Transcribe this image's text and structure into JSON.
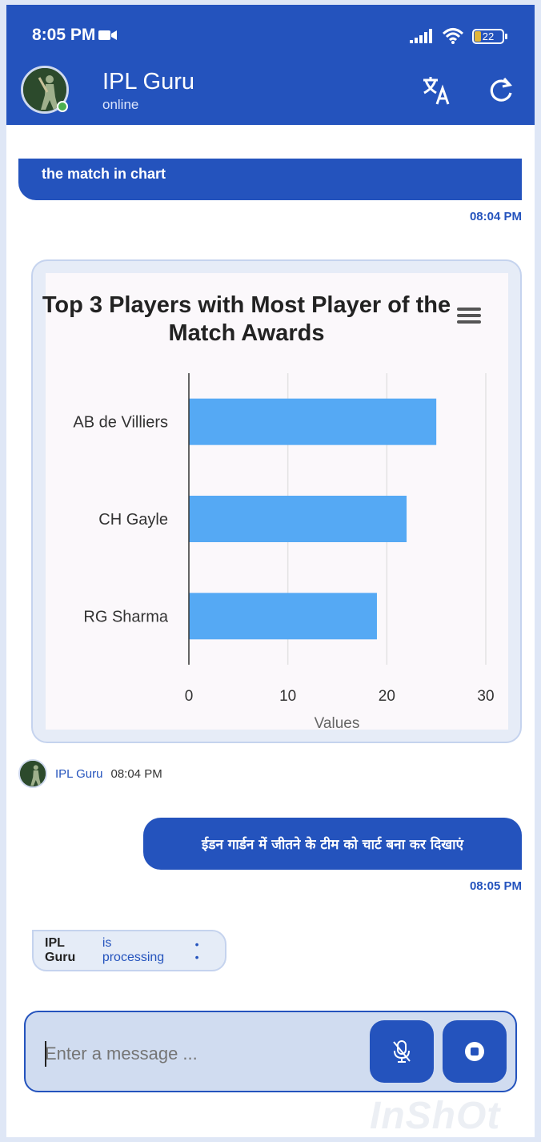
{
  "status_bar": {
    "time": "8:05 PM",
    "battery": "22"
  },
  "header": {
    "title": "IPL Guru",
    "status": "online"
  },
  "messages": {
    "prev_text": "the match in chart",
    "prev_time": "08:04 PM",
    "bot_name": "IPL Guru",
    "bot_time": "08:04 PM",
    "user_text": "ईडन गार्डन में जीतने के टीम को चार्ट बना कर दिखाएं",
    "user_time": "08:05 PM",
    "processing_name": "IPL Guru",
    "processing_status": "is processing"
  },
  "input": {
    "placeholder": "Enter a message ..."
  },
  "chart_data": {
    "type": "bar",
    "orientation": "horizontal",
    "title": "Top 3 Players with Most Player of the Match Awards",
    "categories": [
      "AB de Villiers",
      "CH Gayle",
      "RG Sharma"
    ],
    "values": [
      25,
      22,
      19
    ],
    "xlabel": "Values",
    "ylabel": "",
    "xlim": [
      0,
      30
    ],
    "ticks": [
      0,
      10,
      20,
      30
    ],
    "grid": true,
    "bar_color": "#55a9f4"
  },
  "watermark": "InShOt",
  "colors": {
    "primary": "#2453bd",
    "online": "#4caf50"
  }
}
